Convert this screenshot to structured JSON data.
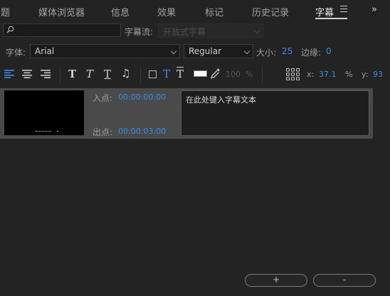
{
  "tabs": [
    {
      "label": "题"
    },
    {
      "label": "媒体浏览器"
    },
    {
      "label": "信息"
    },
    {
      "label": "效果"
    },
    {
      "label": "标记"
    },
    {
      "label": "历史记录"
    },
    {
      "label": "字幕"
    }
  ],
  "overflow_label": "»",
  "search": {
    "placeholder": ""
  },
  "caption_stream": {
    "label": "字幕流:",
    "value": "开放式字幕"
  },
  "font": {
    "label": "字体:",
    "family": "Arial",
    "style": "Regular"
  },
  "size": {
    "label": "大小:",
    "value": "25"
  },
  "margin": {
    "label": "边缘:",
    "value": "0"
  },
  "toolbar": {
    "bold_glyph": "T",
    "italic_glyph": "T",
    "underline_glyph": "T",
    "music_glyph": "♫",
    "text_color_glyph": "T",
    "text_bg_glyph": "T",
    "opacity": "100",
    "opacity_unit": "%",
    "x_label": "x:",
    "x_value": "37.1",
    "x_unit": "%",
    "y_label": "y:",
    "y_value": "93"
  },
  "caption": {
    "in_label": "入点:",
    "in_time": "00:00:00:00",
    "out_label": "出点:",
    "out_time": "00:00:03:00",
    "text": "在此处键入字幕文本"
  },
  "buttons": {
    "add": "+",
    "remove": "-"
  },
  "colors": {
    "accent": "#3a8fe0",
    "panel": "#232323",
    "row": "#4a4a4a"
  }
}
